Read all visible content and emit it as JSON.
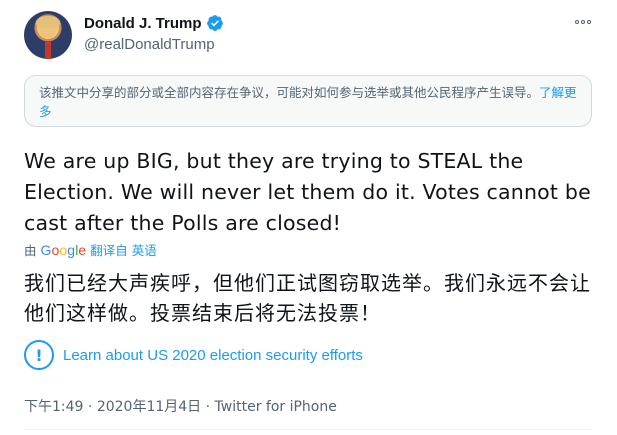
{
  "author": {
    "display_name": "Donald J. Trump",
    "handle": "@realDonaldTrump",
    "avatar_icon": "profile-photo",
    "verified_icon": "verified-badge-icon"
  },
  "more_icon": "more-options-icon",
  "disputed_notice": {
    "text": "该推文中分享的部分或全部内容存在争议，可能对如何参与选举或其他公民程序产生误导。",
    "link_label": "了解更多"
  },
  "tweet_text": "We are up BIG, but they are trying to STEAL the Election. We will never let them do it. Votes cannot be cast after the Polls are closed!",
  "translation": {
    "prefix": "由",
    "provider": "Google",
    "link_label": "翻译自 英语",
    "text": "我们已经大声疾呼，但他们正试图窃取选举。我们永远不会让他们这样做。投票结束后将无法投票！"
  },
  "election_link": {
    "icon": "info-icon",
    "label": "Learn about US 2020 election security efforts"
  },
  "meta": {
    "time": "下午1:49",
    "separator": " · ",
    "date": "2020年11月4日",
    "source": "Twitter for iPhone"
  },
  "colors": {
    "accent": "#1d9bf0",
    "secondary_text": "#536471",
    "primary_text": "#0f1419",
    "notice_background": "#f7f9f9"
  }
}
